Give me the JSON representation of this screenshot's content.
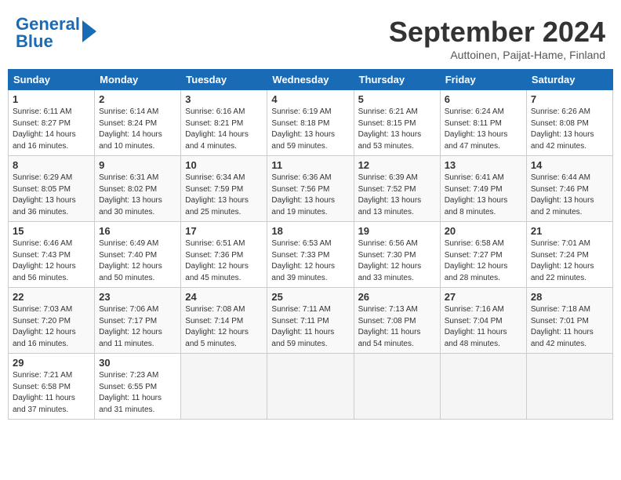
{
  "header": {
    "logo_text1": "General",
    "logo_text2": "Blue",
    "month": "September 2024",
    "location": "Auttoinen, Paijat-Hame, Finland"
  },
  "columns": [
    "Sunday",
    "Monday",
    "Tuesday",
    "Wednesday",
    "Thursday",
    "Friday",
    "Saturday"
  ],
  "weeks": [
    [
      {
        "day": "1",
        "info": "Sunrise: 6:11 AM\nSunset: 8:27 PM\nDaylight: 14 hours\nand 16 minutes."
      },
      {
        "day": "2",
        "info": "Sunrise: 6:14 AM\nSunset: 8:24 PM\nDaylight: 14 hours\nand 10 minutes."
      },
      {
        "day": "3",
        "info": "Sunrise: 6:16 AM\nSunset: 8:21 PM\nDaylight: 14 hours\nand 4 minutes."
      },
      {
        "day": "4",
        "info": "Sunrise: 6:19 AM\nSunset: 8:18 PM\nDaylight: 13 hours\nand 59 minutes."
      },
      {
        "day": "5",
        "info": "Sunrise: 6:21 AM\nSunset: 8:15 PM\nDaylight: 13 hours\nand 53 minutes."
      },
      {
        "day": "6",
        "info": "Sunrise: 6:24 AM\nSunset: 8:11 PM\nDaylight: 13 hours\nand 47 minutes."
      },
      {
        "day": "7",
        "info": "Sunrise: 6:26 AM\nSunset: 8:08 PM\nDaylight: 13 hours\nand 42 minutes."
      }
    ],
    [
      {
        "day": "8",
        "info": "Sunrise: 6:29 AM\nSunset: 8:05 PM\nDaylight: 13 hours\nand 36 minutes."
      },
      {
        "day": "9",
        "info": "Sunrise: 6:31 AM\nSunset: 8:02 PM\nDaylight: 13 hours\nand 30 minutes."
      },
      {
        "day": "10",
        "info": "Sunrise: 6:34 AM\nSunset: 7:59 PM\nDaylight: 13 hours\nand 25 minutes."
      },
      {
        "day": "11",
        "info": "Sunrise: 6:36 AM\nSunset: 7:56 PM\nDaylight: 13 hours\nand 19 minutes."
      },
      {
        "day": "12",
        "info": "Sunrise: 6:39 AM\nSunset: 7:52 PM\nDaylight: 13 hours\nand 13 minutes."
      },
      {
        "day": "13",
        "info": "Sunrise: 6:41 AM\nSunset: 7:49 PM\nDaylight: 13 hours\nand 8 minutes."
      },
      {
        "day": "14",
        "info": "Sunrise: 6:44 AM\nSunset: 7:46 PM\nDaylight: 13 hours\nand 2 minutes."
      }
    ],
    [
      {
        "day": "15",
        "info": "Sunrise: 6:46 AM\nSunset: 7:43 PM\nDaylight: 12 hours\nand 56 minutes."
      },
      {
        "day": "16",
        "info": "Sunrise: 6:49 AM\nSunset: 7:40 PM\nDaylight: 12 hours\nand 50 minutes."
      },
      {
        "day": "17",
        "info": "Sunrise: 6:51 AM\nSunset: 7:36 PM\nDaylight: 12 hours\nand 45 minutes."
      },
      {
        "day": "18",
        "info": "Sunrise: 6:53 AM\nSunset: 7:33 PM\nDaylight: 12 hours\nand 39 minutes."
      },
      {
        "day": "19",
        "info": "Sunrise: 6:56 AM\nSunset: 7:30 PM\nDaylight: 12 hours\nand 33 minutes."
      },
      {
        "day": "20",
        "info": "Sunrise: 6:58 AM\nSunset: 7:27 PM\nDaylight: 12 hours\nand 28 minutes."
      },
      {
        "day": "21",
        "info": "Sunrise: 7:01 AM\nSunset: 7:24 PM\nDaylight: 12 hours\nand 22 minutes."
      }
    ],
    [
      {
        "day": "22",
        "info": "Sunrise: 7:03 AM\nSunset: 7:20 PM\nDaylight: 12 hours\nand 16 minutes."
      },
      {
        "day": "23",
        "info": "Sunrise: 7:06 AM\nSunset: 7:17 PM\nDaylight: 12 hours\nand 11 minutes."
      },
      {
        "day": "24",
        "info": "Sunrise: 7:08 AM\nSunset: 7:14 PM\nDaylight: 12 hours\nand 5 minutes."
      },
      {
        "day": "25",
        "info": "Sunrise: 7:11 AM\nSunset: 7:11 PM\nDaylight: 11 hours\nand 59 minutes."
      },
      {
        "day": "26",
        "info": "Sunrise: 7:13 AM\nSunset: 7:08 PM\nDaylight: 11 hours\nand 54 minutes."
      },
      {
        "day": "27",
        "info": "Sunrise: 7:16 AM\nSunset: 7:04 PM\nDaylight: 11 hours\nand 48 minutes."
      },
      {
        "day": "28",
        "info": "Sunrise: 7:18 AM\nSunset: 7:01 PM\nDaylight: 11 hours\nand 42 minutes."
      }
    ],
    [
      {
        "day": "29",
        "info": "Sunrise: 7:21 AM\nSunset: 6:58 PM\nDaylight: 11 hours\nand 37 minutes."
      },
      {
        "day": "30",
        "info": "Sunrise: 7:23 AM\nSunset: 6:55 PM\nDaylight: 11 hours\nand 31 minutes."
      },
      {
        "day": "",
        "info": ""
      },
      {
        "day": "",
        "info": ""
      },
      {
        "day": "",
        "info": ""
      },
      {
        "day": "",
        "info": ""
      },
      {
        "day": "",
        "info": ""
      }
    ]
  ]
}
